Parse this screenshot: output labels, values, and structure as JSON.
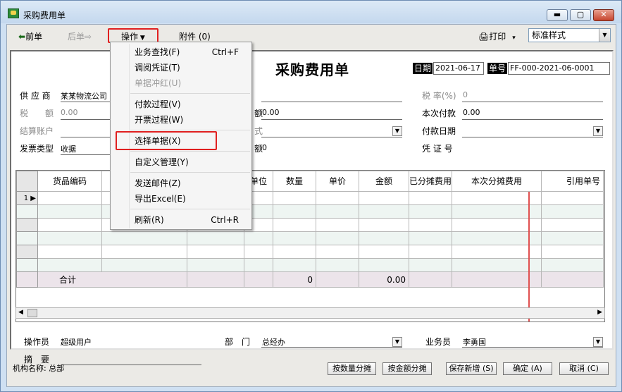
{
  "window": {
    "title": "采购费用单"
  },
  "toolbar": {
    "prev": "前单",
    "next": "后单",
    "operations": "操作",
    "attachments": "附件 (0)",
    "print": "打印",
    "style_value": "标准样式"
  },
  "doc": {
    "title": "采购费用单",
    "date_label": "日期",
    "date_value": "2021-06-17",
    "no_label": "单号",
    "no_value": "FF-000-2021-06-0001"
  },
  "fields": {
    "supplier_label": "供 应 商",
    "supplier_value": "某某物流公司",
    "tax_amount_label": "税　　额",
    "tax_amount_value": "0.00",
    "settle_account_label": "结算账户",
    "invoice_type_label": "发票类型",
    "invoice_type_value": "收据",
    "mid_amount_label": "额",
    "mid_amount_value": "0.00",
    "mid_combo_label": "式",
    "mid_amount2_label": "额",
    "mid_amount2_value": "0",
    "tax_rate_label": "税 率(%)",
    "tax_rate_value": "0",
    "pay_now_label": "本次付款",
    "pay_now_value": "0.00",
    "pay_date_label": "付款日期",
    "voucher_label": "凭 证 号"
  },
  "grid": {
    "columns": [
      "货品编码",
      "",
      "",
      "单位",
      "数量",
      "单价",
      "金额",
      "已分摊费用",
      "本次分摊费用",
      "引用单号"
    ],
    "first_row_marker": "1",
    "total_label": "合计",
    "total_qty": "0",
    "total_amount": "0.00"
  },
  "footer": {
    "operator_label": "操作员",
    "operator_value": "超级用户",
    "dept_label": "部　门",
    "dept_value": "总经办",
    "salesman_label": "业务员",
    "salesman_value": "李勇国",
    "summary_label": "摘　要"
  },
  "status": {
    "org": "机构名称: 总部",
    "btn_by_qty": "按数量分摊",
    "btn_by_amount": "按金额分摊",
    "btn_save_new": "保存新增 (S)",
    "btn_ok": "确定 (A)",
    "btn_cancel": "取消 (C)"
  },
  "menu": {
    "items": [
      {
        "label": "业务查找(F)",
        "shortcut": "Ctrl+F"
      },
      {
        "label": "调阅凭证(T)",
        "shortcut": ""
      },
      {
        "label": "单据冲红(U)",
        "shortcut": ""
      },
      {
        "label": "付款过程(V)",
        "shortcut": ""
      },
      {
        "label": "开票过程(W)",
        "shortcut": ""
      },
      {
        "label": "选择单据(X)",
        "shortcut": ""
      },
      {
        "label": "自定义管理(Y)",
        "shortcut": ""
      },
      {
        "label": "发送邮件(Z)",
        "shortcut": ""
      },
      {
        "label": "导出Excel(E)",
        "shortcut": ""
      },
      {
        "label": "刷新(R)",
        "shortcut": "Ctrl+R"
      }
    ]
  },
  "colors": {
    "highlight": "#e02020",
    "title_bg": "#cfe0f2"
  }
}
